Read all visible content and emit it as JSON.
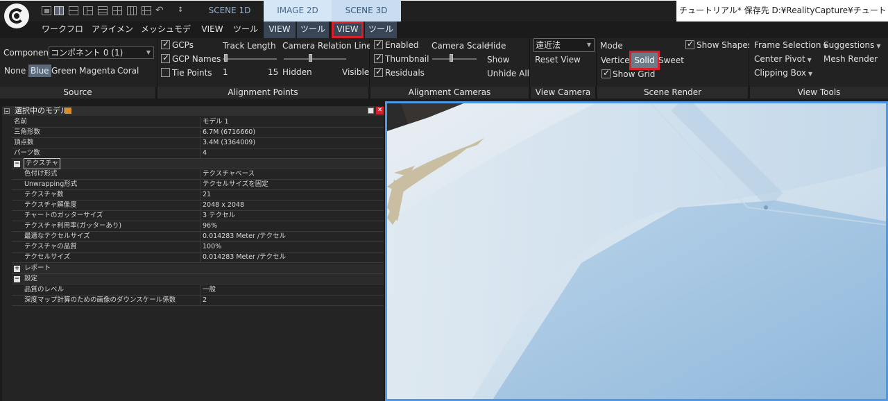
{
  "title_bar": {
    "modes": [
      "SCENE 1D",
      "IMAGE 2D",
      "SCENE 3D"
    ],
    "window_title": "チュートリアル* 保存先 D:¥RealityCapture¥チュートリアル - Re"
  },
  "menu": {
    "items": [
      "ワークフロー",
      "アライメント",
      "メッシュモデル",
      "VIEW",
      "ツール",
      "VIEW",
      "ツール",
      "VIEW",
      "ツール"
    ]
  },
  "ribbon": {
    "source": {
      "component_label": "Component",
      "component_value": "コンポネント 0 (1)",
      "colors": [
        "None",
        "Blue",
        "Green",
        "Magenta",
        "Coral"
      ],
      "selected_color": "Blue"
    },
    "alignment_points": {
      "gcps": "GCPs",
      "gcp_names": "GCP Names",
      "tie_points": "Tie Points",
      "track_length": "Track Length",
      "track_min": "1",
      "track_max": "15",
      "camera_relation_lines": "Camera Relation Lines",
      "hidden": "Hidden",
      "visible": "Visible"
    },
    "alignment_cameras": {
      "enabled": "Enabled",
      "thumbnail": "Thumbnail",
      "residuals": "Residuals",
      "camera_scale": "Camera Scale",
      "hide": "Hide",
      "show": "Show",
      "unhide_all": "Unhide All"
    },
    "view_camera": {
      "projection": "遠近法",
      "reset_view": "Reset View"
    },
    "scene_render": {
      "mode": "Mode",
      "show_shapes": "Show Shapes",
      "vertices": "Vertices",
      "solid": "Solid",
      "sweet": "Sweet",
      "show_grid": "Show Grid"
    },
    "view_tools": {
      "frame_selection": "Frame Selection",
      "suggestions": "Suggestions",
      "center_pivot": "Center Pivot",
      "mesh_render": "Mesh Render",
      "clipping_box": "Clipping Box"
    }
  },
  "section_labels": [
    "Source",
    "Alignment Points",
    "Alignment Cameras",
    "View Camera",
    "Scene Render",
    "View Tools"
  ],
  "panel": {
    "title": "選択中のモデル",
    "rows": [
      {
        "k": "名前",
        "v": "モデル 1"
      },
      {
        "k": "三角形数",
        "v": "6.7M (6716660)"
      },
      {
        "k": "頂点数",
        "v": "3.4M (3364009)"
      },
      {
        "k": "パーツ数",
        "v": "4"
      }
    ],
    "texture_group": "テクスチャ",
    "texture_rows": [
      {
        "k": "色付け形式",
        "v": "テクスチャベース"
      },
      {
        "k": "Unwrapping形式",
        "v": "テクセルサイズを固定"
      },
      {
        "k": "テクスチャ数",
        "v": "21"
      },
      {
        "k": "テクスチャ解像度",
        "v": "2048 x 2048"
      },
      {
        "k": "チャートのガッターサイズ",
        "v": "3 テクセル"
      },
      {
        "k": "テクスチャ利用率(ガッターあり)",
        "v": "96%"
      },
      {
        "k": "最適なテクセルサイズ",
        "v": "0.014283 Meter /テクセル"
      },
      {
        "k": "テクスチャの品質",
        "v": "100%"
      },
      {
        "k": "テクセルサイズ",
        "v": "0.014283 Meter /テクセル"
      }
    ],
    "report_group": "レポート",
    "settings_group": "設定",
    "settings_rows": [
      {
        "k": "品質のレベル",
        "v": "一般"
      },
      {
        "k": "深度マップ計算のための画像のダウンスケール係数",
        "v": "2"
      }
    ]
  },
  "colors": {
    "accent_blue": "#4f98e8",
    "highlight_red": "#d81f2a",
    "selected_pill": "#5b6a7b"
  }
}
